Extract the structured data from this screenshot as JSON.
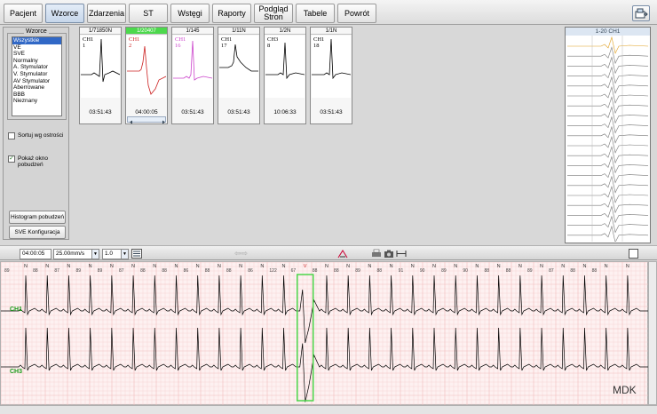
{
  "toolbar": {
    "buttons": [
      "Pacjent",
      "Wzorce",
      "Zdarzenia",
      "ST",
      "Wstęgi",
      "Raporty",
      "Podgląd\nStron",
      "Tabele",
      "Powrót"
    ],
    "active": "Wzorce",
    "right_icon": "export-icon"
  },
  "left_panel": {
    "group_title": "Wzorce",
    "filters": [
      "Wszystkie",
      "VE",
      "SVE",
      "Normalny",
      "A. Stymulator",
      "V. Stymulator",
      "AV Stymulator",
      "Aberrowane",
      "BBB",
      "Nieznany"
    ],
    "selected_filter": "Wszystkie",
    "sort_label": "Sortuj wg ostrości",
    "sort_checked": false,
    "show_window_label": "Pokaż okno pobudzeń",
    "show_window_checked": true,
    "histogram_button": "Histogram pobudzeń",
    "sve_button": "SVE Konfiguracja"
  },
  "templates": [
    {
      "header": "1/71850N",
      "ch": "CH1",
      "num": "1",
      "time": "03:51:43",
      "color": "#000000",
      "selected": false
    },
    {
      "header": "1/20407",
      "ch": "CH1",
      "num": "2",
      "time": "04:00:05",
      "color": "#cc2222",
      "selected": true
    },
    {
      "header": "1/145",
      "ch": "CH1",
      "num": "16",
      "time": "03:51:43",
      "color": "#cc44cc",
      "selected": false
    },
    {
      "header": "1/11N",
      "ch": "CH1",
      "num": "17",
      "time": "03:51:43",
      "color": "#000000",
      "selected": false
    },
    {
      "header": "1/2N",
      "ch": "CH3",
      "num": "8",
      "time": "10:06:33",
      "color": "#000000",
      "selected": false
    },
    {
      "header": "1/1N",
      "ch": "CH1",
      "num": "18",
      "time": "03:51:43",
      "color": "#000000",
      "selected": false
    }
  ],
  "overlay": {
    "title": "1-20 CH1"
  },
  "strip_toolbar": {
    "time": "04:00:05",
    "speed": "25.00mm/s",
    "gain": "1.0"
  },
  "ecg": {
    "channels": [
      "CH1",
      "CH3"
    ],
    "beat_labels": [
      "N",
      "N",
      "N",
      "N",
      "N",
      "N",
      "N",
      "N",
      "N",
      "N",
      "N",
      "N",
      "N",
      "V",
      "N",
      "N",
      "N",
      "N",
      "N",
      "N",
      "N",
      "N",
      "N",
      "N",
      "N",
      "N",
      "N",
      "N",
      "N"
    ],
    "intervals": [
      "89",
      "88",
      "87",
      "89",
      "89",
      "87",
      "88",
      "88",
      "86",
      "88",
      "88",
      "86",
      "122",
      "67",
      "88",
      "88",
      "89",
      "88",
      "91",
      "90",
      "89",
      "90",
      "88",
      "88",
      "89",
      "87",
      "88",
      "88"
    ],
    "brand": "MDK"
  },
  "colors": {
    "accent": "#3168c6",
    "grid": "#f2bcbc",
    "ecg_trace": "#000000",
    "highlight": "#4cd84c",
    "abnormal": "#cc2222"
  }
}
